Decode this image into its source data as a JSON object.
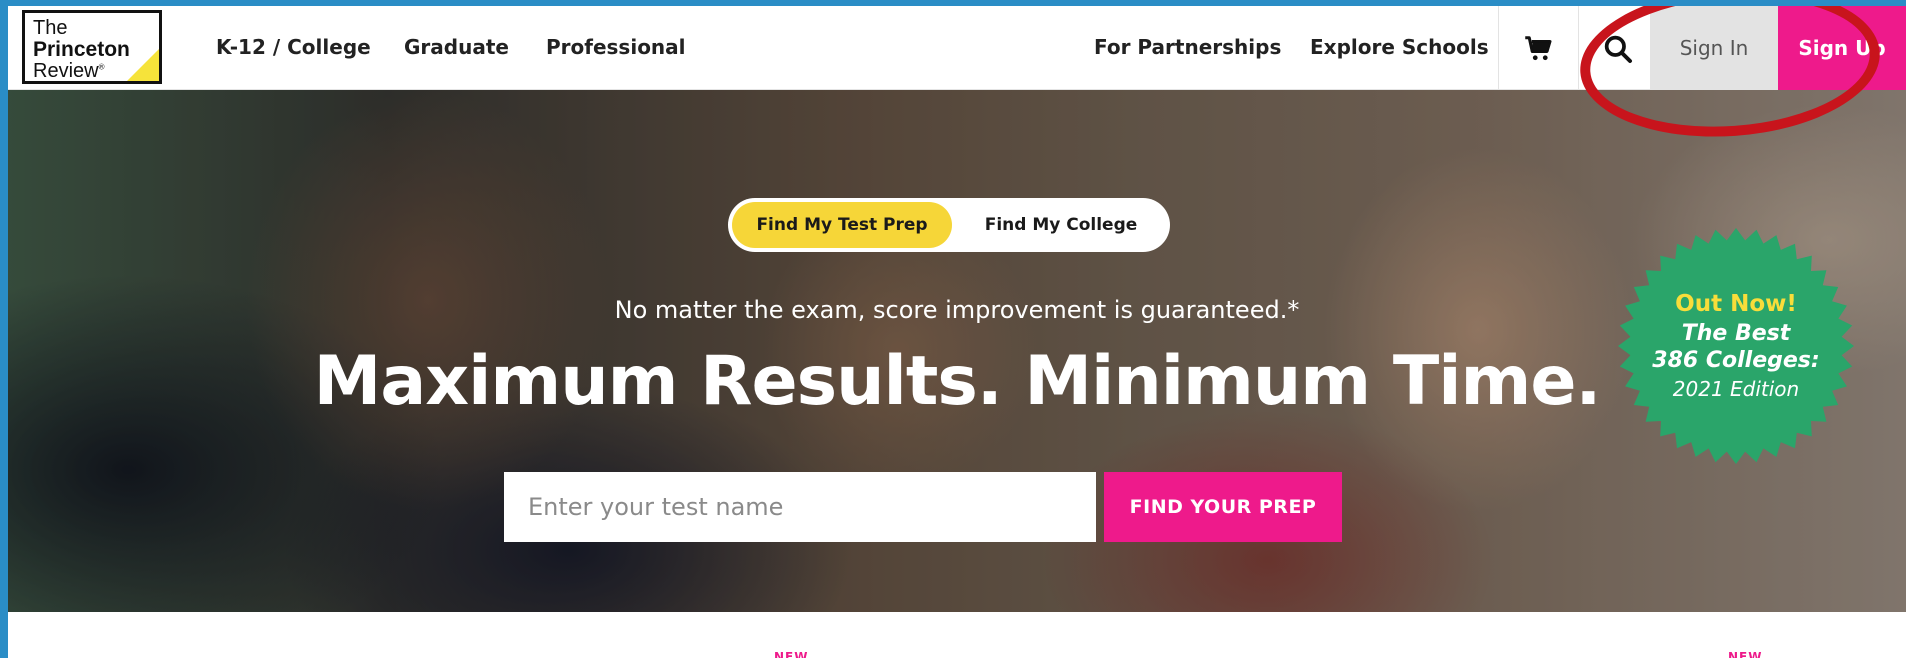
{
  "brand": {
    "logo_line1": "The",
    "logo_line2": "Princeton",
    "logo_line3": "Review",
    "logo_mark": "®",
    "accent_yellow": "#f6d638",
    "accent_pink": "#ee1a8b"
  },
  "nav": {
    "left_links": [
      "K-12 / College",
      "Graduate",
      "Professional"
    ],
    "right_links": [
      "For Partnerships",
      "Explore Schools"
    ],
    "cart_icon": "shopping-cart-icon",
    "search_icon": "search-icon",
    "sign_in": "Sign In",
    "sign_up": "Sign Up"
  },
  "hero": {
    "toggle": {
      "active": "Find My Test Prep",
      "inactive": "Find My College"
    },
    "subtitle": "No matter the exam, score improvement is guaranteed.*",
    "headline": "Maximum Results. Minimum Time.",
    "search": {
      "placeholder": "Enter your test name",
      "button": "FIND YOUR PREP"
    },
    "badge": {
      "line1": "Out Now!",
      "line2": "The Best",
      "line3": "386 Colleges:",
      "line4": "2021 Edition",
      "color": "#2aa56a"
    }
  },
  "below": {
    "tags": [
      "NEW",
      "NEW"
    ]
  }
}
